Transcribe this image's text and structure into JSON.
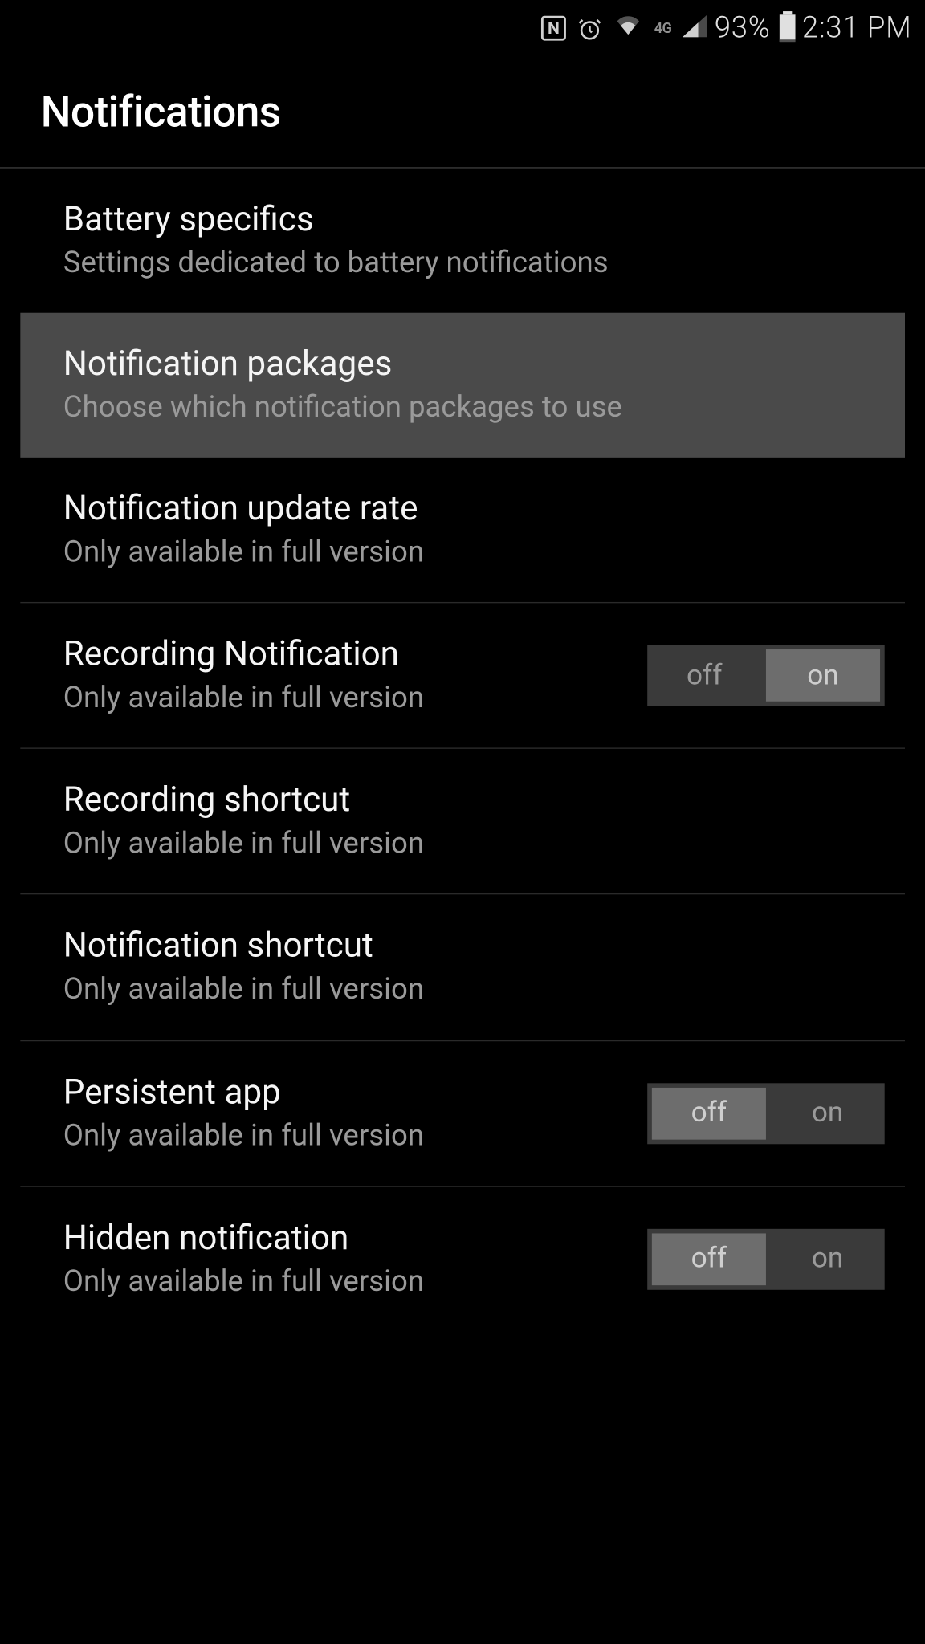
{
  "status": {
    "battery_percent": "93%",
    "time": "2:31 PM",
    "network_type": "4G"
  },
  "header": {
    "title": "Notifications"
  },
  "items": [
    {
      "title": "Battery specifics",
      "subtitle": "Settings dedicated to battery notifications"
    },
    {
      "title": "Notification packages",
      "subtitle": "Choose which notification packages to use"
    },
    {
      "title": "Notification update rate",
      "subtitle": "Only available in full version"
    },
    {
      "title": "Recording Notification",
      "subtitle": "Only available in full version",
      "toggle": {
        "off": "off",
        "on": "on",
        "state": "on"
      }
    },
    {
      "title": "Recording shortcut",
      "subtitle": "Only available in full version"
    },
    {
      "title": "Notification shortcut",
      "subtitle": "Only available in full version"
    },
    {
      "title": "Persistent app",
      "subtitle": "Only available in full version",
      "toggle": {
        "off": "off",
        "on": "on",
        "state": "off"
      }
    },
    {
      "title": "Hidden notification",
      "subtitle": "Only available in full version",
      "toggle": {
        "off": "off",
        "on": "on",
        "state": "off"
      }
    }
  ]
}
